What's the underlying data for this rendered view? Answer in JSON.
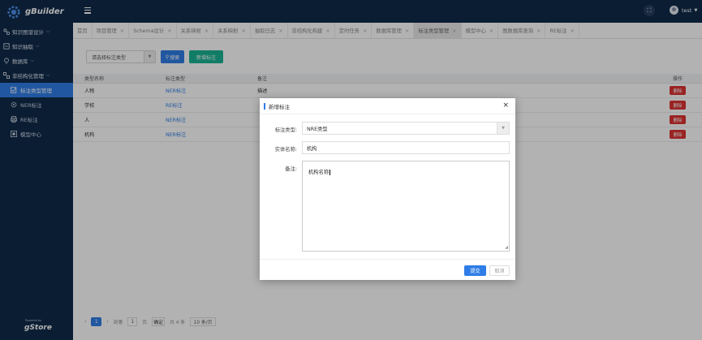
{
  "app": {
    "brand": "gBuilder",
    "powered_small": "Powered by",
    "powered_brand": "gStore"
  },
  "sidebar": {
    "items": [
      {
        "label": "知识图谱设计",
        "icon": "graph-icon"
      },
      {
        "label": "知识抽取",
        "icon": "extract-icon"
      },
      {
        "label": "数据库",
        "icon": "location-icon"
      },
      {
        "label": "非结构化管理",
        "icon": "hierarchy-icon"
      }
    ],
    "subitems": [
      {
        "label": "标注类型管理",
        "icon": "tag-check-icon",
        "active": true
      },
      {
        "label": "NER标注",
        "icon": "gear-icon"
      },
      {
        "label": "RE标注",
        "icon": "printer-icon"
      },
      {
        "label": "模型中心",
        "icon": "box-icon"
      }
    ]
  },
  "header": {
    "username": "test"
  },
  "tabs": [
    {
      "label": "首页",
      "closable": false
    },
    {
      "label": "项目管理",
      "closable": true
    },
    {
      "label": "Schema设计",
      "closable": true
    },
    {
      "label": "关系映射",
      "closable": true
    },
    {
      "label": "关系映射",
      "closable": true
    },
    {
      "label": "抽取日志",
      "closable": true
    },
    {
      "label": "非结构化构建",
      "closable": true
    },
    {
      "label": "定时任务",
      "closable": true
    },
    {
      "label": "数据库管理",
      "closable": true
    },
    {
      "label": "标注类型管理",
      "closable": true,
      "active": true
    },
    {
      "label": "模型中心",
      "closable": true
    },
    {
      "label": "图数据库查询",
      "closable": true
    },
    {
      "label": "RE标注",
      "closable": true
    }
  ],
  "toolbar": {
    "select_placeholder": "请选择标注类型",
    "search_label": "搜索",
    "add_label": "新增标注"
  },
  "table": {
    "headers": [
      "类型名称",
      "标注类型",
      "备注",
      "操作"
    ],
    "rows": [
      {
        "name": "人物",
        "type": "NER标注",
        "note": "描述",
        "action": "删除"
      },
      {
        "name": "学校",
        "type": "RE标注",
        "note": "",
        "action": "删除"
      },
      {
        "name": "人",
        "type": "NER标注",
        "note": "",
        "action": "删除"
      },
      {
        "name": "机构",
        "type": "NER标注",
        "note": "",
        "action": "删除"
      }
    ]
  },
  "pagination": {
    "current_page": "1",
    "goto_label": "到第",
    "goto_value": "1",
    "page_unit": "页",
    "confirm_label": "确定",
    "total_label": "共 4 条",
    "page_size_label": "10 条/页"
  },
  "modal": {
    "title": "新增标注",
    "type_label": "标注类型:",
    "type_value": "NRE类型",
    "name_label": "实体名称:",
    "name_value": "机构",
    "note_label": "备注:",
    "note_value": "机构名称",
    "submit_label": "提交",
    "cancel_label": "取消"
  },
  "colors": {
    "sidebar_bg": "#0f2a4a",
    "primary": "#2f7de6",
    "success": "#1ab394",
    "danger": "#dd3333"
  }
}
